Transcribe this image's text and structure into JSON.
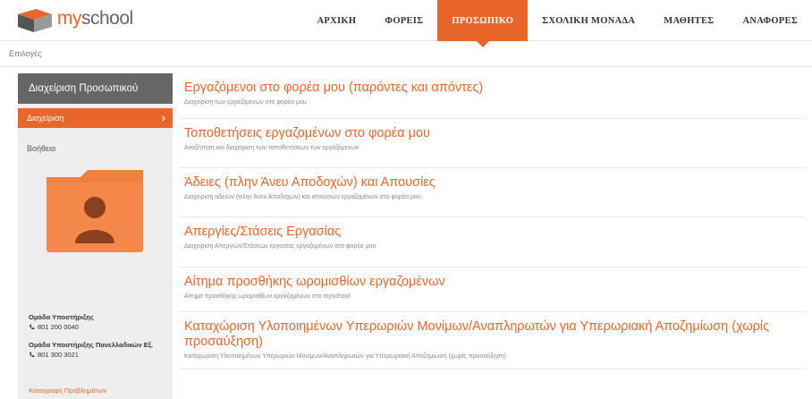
{
  "header": {
    "logo_text": "myschool",
    "nav": [
      {
        "label": "ΑΡΧΙΚΗ",
        "active": false
      },
      {
        "label": "ΦΟΡΕΙΣ",
        "active": false
      },
      {
        "label": "ΠΡΟΣΩΠΙΚΟ",
        "active": true
      },
      {
        "label": "ΣΧΟΛΙΚΗ ΜΟΝΑΔΑ",
        "active": false
      },
      {
        "label": "ΜΑΘΗΤΕΣ",
        "active": false
      },
      {
        "label": "ΑΝΑΦΟΡΕΣ",
        "active": false
      }
    ]
  },
  "breadcrumb": "Επιλογές",
  "sidebar": {
    "heading": "Διαχείριση Προσωπικού",
    "items": [
      {
        "label": "Διαχείριση",
        "active": true
      },
      {
        "label": "Βοήθεια",
        "active": false
      }
    ],
    "support": [
      {
        "title": "Ομάδα Υποστήριξης",
        "phone": "801 200 0040"
      },
      {
        "title": "Ομάδα Υποστήριξης Πανελλαδικών Εξ.",
        "phone": "801 300 3021"
      }
    ],
    "link": "Καταγραφή Προβλημάτων"
  },
  "entries": [
    {
      "title": "Εργαζόμενοι στο φορέα μου (παρόντες και απόντες)",
      "desc": "Διαχείριση των εργαζόμενων στο φορέα μου"
    },
    {
      "title": "Τοποθετήσεις εργαζομένων στο φορέα μου",
      "desc": "Αναζήτηση και διαχείριση των τοποθετήσεων των εργαζόμενων"
    },
    {
      "title": "Άδειες (πλην Άνευ Αποδοχών) και Απουσίες",
      "desc": "Διαχείριση αδειών (πλην Άνευ Αποδοχών) και απουσιών εργαζομένων στο φορέα μου"
    },
    {
      "title": "Απεργίες/Στάσεις Εργασίας",
      "desc": "Διαχείριση Απεργιών/Στάσεων εργασίας εργαζομένων στο φορέα μου"
    },
    {
      "title": "Αίτημα προσθήκης ωρομισθίων εργαζομένων",
      "desc": "Αίτημα προσθήκης ωρομισθίων εργαζομένων στο myschool"
    },
    {
      "title": "Καταχώριση Υλοποιημένων Υπερωριών Μονίμων/Αναπληρωτών για Υπερωριακή Αποζημίωση (χωρίς προσαύξηση)",
      "desc": "Καταχώριση Υλοποιημένων Υπερωριών Μονίμων/Αναπληρωτών για Υπερωριακή Αποζημίωση (χωρίς προσαύξηση)"
    }
  ],
  "colors": {
    "accent": "#e8662a",
    "sidebar_head": "#666666",
    "sidebar_bg": "#eeeeee"
  },
  "icons": [
    "logo-icon",
    "chevron-right-icon",
    "user-folder-icon",
    "phone-icon"
  ]
}
